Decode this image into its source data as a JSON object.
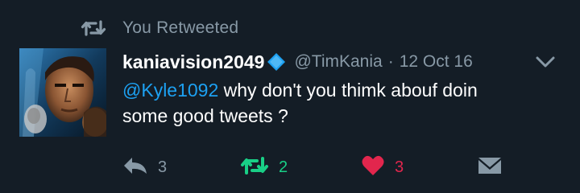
{
  "retweet_context": {
    "label": "You Retweeted",
    "icon": "retweet-icon"
  },
  "tweet": {
    "author": {
      "display_name": "kaniavision2049",
      "verified_icon": "verified-diamond-icon",
      "handle": "@TimKania",
      "separator": "·",
      "date": "12 Oct 16"
    },
    "text": {
      "mention": "@Kyle1092",
      "line1_rest": " why don't you thimk abouf doin",
      "line2": "some good tweets ?"
    },
    "actions": {
      "reply": {
        "count": "3",
        "icon": "reply-icon"
      },
      "retweet": {
        "count": "2",
        "icon": "retweet-icon",
        "active": true
      },
      "like": {
        "count": "3",
        "icon": "heart-icon",
        "active": true
      },
      "dm": {
        "icon": "envelope-icon"
      }
    },
    "menu_icon": "chevron-down-icon"
  },
  "colors": {
    "background": "#141d26",
    "text_primary": "#ffffff",
    "text_secondary": "#8899a6",
    "link": "#1da1f2",
    "retweet_active": "#19cf86",
    "like_active": "#e2264d",
    "verified": "#1da1f2"
  }
}
